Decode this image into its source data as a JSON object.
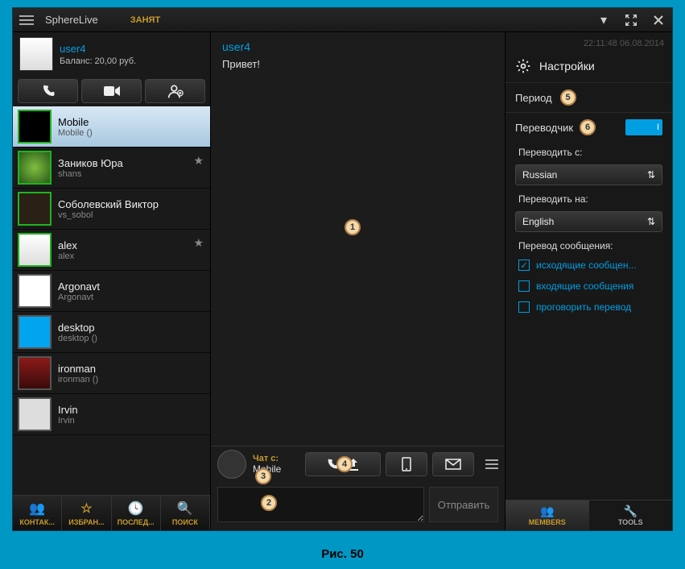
{
  "app": {
    "title": "SphereLive",
    "status": "ЗАНЯТ"
  },
  "user": {
    "name": "user4",
    "balance": "Баланс: 20,00 руб."
  },
  "contacts": [
    {
      "name": "Mobile",
      "sub": "Mobile ()",
      "starred": false,
      "selected": true
    },
    {
      "name": "Заников Юра",
      "sub": "shans",
      "starred": true,
      "selected": false
    },
    {
      "name": "Соболевский Виктор",
      "sub": "vs_sobol",
      "starred": false,
      "selected": false
    },
    {
      "name": "alex",
      "sub": "alex",
      "starred": true,
      "selected": false
    },
    {
      "name": "Argonavt",
      "sub": "Argonavt",
      "starred": false,
      "selected": false
    },
    {
      "name": "desktop",
      "sub": "desktop ()",
      "starred": false,
      "selected": false
    },
    {
      "name": "ironman",
      "sub": "ironman ()",
      "starred": false,
      "selected": false
    },
    {
      "name": "Irvin",
      "sub": "Irvin",
      "starred": false,
      "selected": false
    }
  ],
  "bottomTabs": [
    "КОНТАК...",
    "ИЗБРАН...",
    "ПОСЛЕД...",
    "ПОИСК"
  ],
  "chat": {
    "username": "user4",
    "timestamp": "22:11:48  06.08.2014",
    "message": "Привет!",
    "withLabel": "Чат с:",
    "withName": "Mobile",
    "sendLabel": "Отправить"
  },
  "settings": {
    "title": "Настройки",
    "period": "Период",
    "translator": "Переводчик",
    "toggleState": "I",
    "translateFromLabel": "Переводить с:",
    "translateFrom": "Russian",
    "translateToLabel": "Переводить на:",
    "translateTo": "English",
    "translateMsgLabel": "Перевод сообщения:",
    "checks": [
      {
        "label": "исходящие сообщен...",
        "checked": true
      },
      {
        "label": "входящие сообщения",
        "checked": false
      },
      {
        "label": "проговорить перевод",
        "checked": false
      }
    ],
    "tabs": {
      "members": "MEMBERS",
      "tools": "TOOLS"
    }
  },
  "markers": {
    "1": "1",
    "2": "2",
    "3": "3",
    "4": "4",
    "5": "5",
    "6": "6"
  },
  "caption": "Рис. 50"
}
